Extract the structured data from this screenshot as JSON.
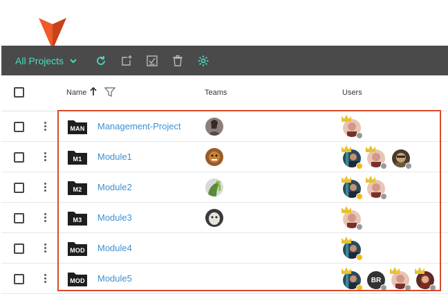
{
  "colors": {
    "accent": "#43e0c0",
    "toolbar_bg": "#4a4a4a",
    "link": "#3d8fd0",
    "highlight_border": "#d84a2a",
    "pointer": "#f05a28"
  },
  "toolbar": {
    "project_selector": "All Projects",
    "icons": [
      "chevron-down-icon",
      "refresh-icon",
      "add-project-icon",
      "checklist-icon",
      "trash-icon",
      "gear-icon"
    ]
  },
  "table": {
    "headers": {
      "name": "Name",
      "teams": "Teams",
      "users": "Users"
    },
    "rows": [
      {
        "tag": "MAN",
        "name": "Management-Project",
        "users": [
          "avatar-gray"
        ]
      },
      {
        "tag": "M1",
        "name": "Module1",
        "users": [
          "avatar-yellow",
          "avatar-gray",
          "avatar-gray"
        ]
      },
      {
        "tag": "M2",
        "name": "Module2",
        "users": [
          "avatar-yellow",
          "avatar-gray"
        ]
      },
      {
        "tag": "M3",
        "name": "Module3",
        "users": [
          "avatar-gray"
        ]
      },
      {
        "tag": "MOD",
        "name": "Module4",
        "users": [
          "avatar-yellow"
        ]
      },
      {
        "tag": "MOD",
        "name": "Module5",
        "users": [
          "avatar-yellow",
          "BR",
          "avatar-gray",
          "avatar-gray"
        ]
      }
    ]
  }
}
